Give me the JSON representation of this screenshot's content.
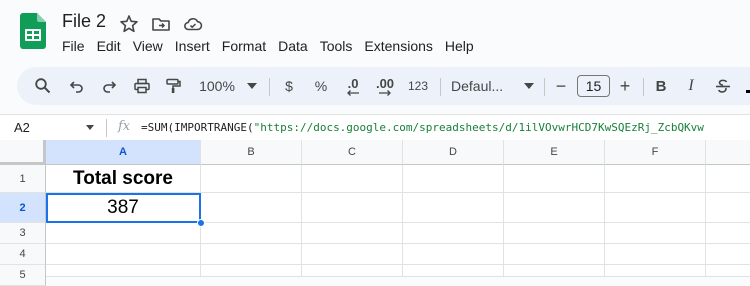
{
  "app": {
    "doc_title": "File 2",
    "colors": {
      "brand_green": "#0f9d58",
      "selection_blue": "#1a73e8",
      "header_selected_bg": "#d3e3fd"
    }
  },
  "title_icons": [
    "star-icon",
    "move-to-folder-icon",
    "cloud-status-icon"
  ],
  "menu": [
    "File",
    "Edit",
    "View",
    "Insert",
    "Format",
    "Data",
    "Tools",
    "Extensions",
    "Help"
  ],
  "toolbar": {
    "zoom": "100%",
    "currency": "$",
    "percent": "%",
    "decrease_decimal": ".0",
    "increase_decimal": ".00",
    "number_format": "123",
    "font": "Defaul...",
    "font_size": "15",
    "minus": "−",
    "plus": "+",
    "bold": "B",
    "italic": "I"
  },
  "formula_bar": {
    "name_box": "A2",
    "fx": "fx",
    "formula_prefix": "=SUM(IMPORTRANGE(",
    "formula_string": "\"https://docs.google.com/spreadsheets/d/1ilVOvwrHCD7KwSQEzRj_ZcbQKvw"
  },
  "grid": {
    "columns": [
      "A",
      "B",
      "C",
      "D",
      "E",
      "F"
    ],
    "rows": [
      "1",
      "2",
      "3",
      "4",
      "5"
    ],
    "cells": {
      "A1": "Total score",
      "A2": "387"
    },
    "selected_cell": "A2"
  }
}
